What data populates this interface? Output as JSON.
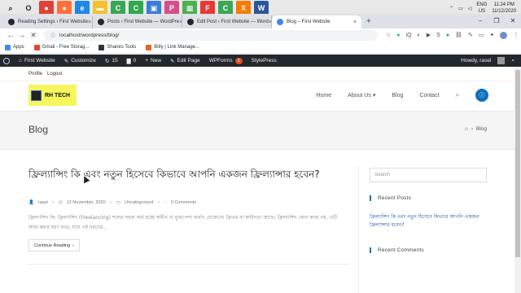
{
  "taskbar": {
    "apps": [
      {
        "icon": "search-icon",
        "glyph": "⌕",
        "color": "#e8e8e8",
        "fg": "#222"
      },
      {
        "icon": "task-view-icon",
        "glyph": "O",
        "color": "#e8e8e8",
        "fg": "#222"
      },
      {
        "icon": "chrome-icon",
        "glyph": "●",
        "color": "#db4437",
        "fg": "#fff"
      },
      {
        "icon": "firefox-icon",
        "glyph": "●",
        "color": "#ff7139",
        "fg": "#fff"
      },
      {
        "icon": "edge-icon",
        "glyph": "e",
        "color": "#1e88e5",
        "fg": "#fff"
      },
      {
        "icon": "file-explorer-icon",
        "glyph": "▬",
        "color": "#f2c230",
        "fg": "#fff"
      },
      {
        "icon": "camtasia-icon",
        "glyph": "C",
        "color": "#3aa757",
        "fg": "#fff"
      },
      {
        "icon": "app-c-icon",
        "glyph": "C",
        "color": "#2fa84f",
        "fg": "#fff"
      },
      {
        "icon": "store-icon",
        "glyph": "▣",
        "color": "#3b7bd8",
        "fg": "#fff"
      },
      {
        "icon": "photoshop-icon",
        "glyph": "P",
        "color": "#d94c8a",
        "fg": "#fff"
      },
      {
        "icon": "gallery-icon",
        "glyph": "▦",
        "color": "#4caf50",
        "fg": "#fff"
      },
      {
        "icon": "app-f-icon",
        "glyph": "F",
        "color": "#e53935",
        "fg": "#fff"
      },
      {
        "icon": "camtasia-recorder-icon",
        "glyph": "C",
        "color": "#3aa757",
        "fg": "#fff"
      },
      {
        "icon": "xampp-icon",
        "glyph": "X",
        "color": "#f57c00",
        "fg": "#fff"
      },
      {
        "icon": "word-icon",
        "glyph": "W",
        "color": "#2b579a",
        "fg": "#fff"
      }
    ],
    "language": "ENG",
    "region": "US",
    "time": "11:24 PM",
    "date": "11/12/2020"
  },
  "browser": {
    "tabs": [
      {
        "label": "Reading Settings ‹ First Website",
        "fav_color": "#23282d",
        "active": false
      },
      {
        "label": "Posts ‹ First Website — WordPre",
        "fav_color": "#23282d",
        "active": false
      },
      {
        "label": "Edit Post ‹ First Website — Word",
        "fav_color": "#23282d",
        "active": false
      },
      {
        "label": "Blog – First Website",
        "fav_color": "#4285f4",
        "active": true
      }
    ],
    "new_tab": "+",
    "window_controls": {
      "minimize": "–",
      "maximize": "❐",
      "close": "✕"
    },
    "url": "localhost/wordpress/blog/",
    "bookmarks": [
      {
        "label": "Apps",
        "color": "#4285f4"
      },
      {
        "label": "Gmail - Free Storag...",
        "color": "#ea4335"
      },
      {
        "label": "Shanes Tools",
        "color": "#333333"
      },
      {
        "label": "Bitly | Link Manage...",
        "color": "#ee6123"
      }
    ]
  },
  "wp_admin_bar": {
    "site": "First Website",
    "customize": "Customize",
    "updates": "15",
    "comments": "0",
    "new": "New",
    "edit_page": "Edit Page",
    "wpforms": "WPForms",
    "wpforms_badge": "2",
    "styles": "StylePress",
    "howdy": "Howdy, rasel"
  },
  "profile_links": [
    "Profile",
    "Logout"
  ],
  "site": {
    "logo_text": "RH TECH",
    "nav": [
      "Home",
      "About Us",
      "Blog",
      "Contact"
    ],
    "about_caret": "▾"
  },
  "page": {
    "title": "Blog",
    "breadcrumb_current": "Blog"
  },
  "post": {
    "title": "ফ্রিল্যান্সিং কি এবং নতুন হিসেবে কিভাবে আপনি একজন ফ্রিল্যান্সার হবেন?",
    "author": "rasel",
    "date": "12 November, 2020",
    "category": "Uncategorized",
    "comments": "0 Comments",
    "excerpt": "ফ্রিল্যান্সিং কি: ফ্রিল্যান্সিং (Freelancing) শব্দের সহজ অর্থ হচ্ছে স্বাধীন বা মুক্তপেশা অর্থাৎ যেকোনো ফ্রিডম বা স্বাধীনতা আছে। ফ্রিল্যান্সিং কোন কাজ নয়, এটি কাজ করার ধরণ মাত্র। যারা এই ধরণের...",
    "read_more": "Continue Reading",
    "read_more_arrow": "›"
  },
  "sidebar": {
    "search_placeholder": "Search",
    "recent_posts_title": "Recent Posts",
    "recent_post": "ফ্রিল্যান্সিং কি এবং নতুন হিসেবে কিভাবে আপনি একজন ফ্রিল্যান্সার হবেন?",
    "recent_comments_title": "Recent Comments"
  }
}
